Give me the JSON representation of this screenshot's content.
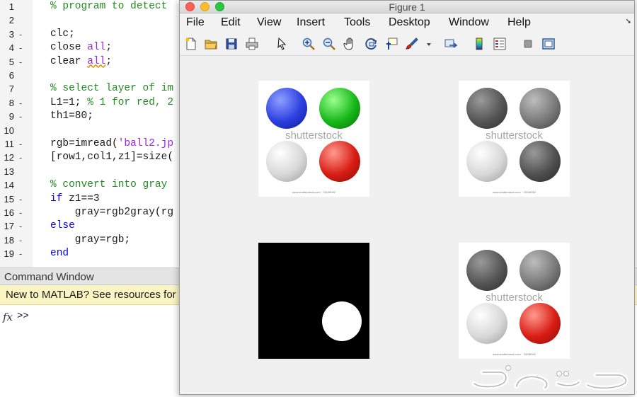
{
  "editor": {
    "lines": [
      {
        "num": "1",
        "marker": "",
        "code": "% program to detect "
      },
      {
        "num": "2",
        "marker": "",
        "code": ""
      },
      {
        "num": "3",
        "marker": "-",
        "code": "clc;"
      },
      {
        "num": "4",
        "marker": "-",
        "code": "close all;"
      },
      {
        "num": "5",
        "marker": "-",
        "code": "clear all;"
      },
      {
        "num": "6",
        "marker": "",
        "code": ""
      },
      {
        "num": "7",
        "marker": "",
        "code": "% select layer of im"
      },
      {
        "num": "8",
        "marker": "-",
        "code": "L1=1; % 1 for red, 2"
      },
      {
        "num": "9",
        "marker": "-",
        "code": "th1=80;"
      },
      {
        "num": "10",
        "marker": "",
        "code": ""
      },
      {
        "num": "11",
        "marker": "-",
        "code": "rgb=imread('ball2.jp"
      },
      {
        "num": "12",
        "marker": "-",
        "code": "[row1,col1,z1]=size("
      },
      {
        "num": "13",
        "marker": "",
        "code": ""
      },
      {
        "num": "14",
        "marker": "",
        "code": "% convert into gray "
      },
      {
        "num": "15",
        "marker": "-",
        "code": "if z1==3"
      },
      {
        "num": "16",
        "marker": "-",
        "code": "    gray=rgb2gray(rg"
      },
      {
        "num": "17",
        "marker": "-",
        "code": "else"
      },
      {
        "num": "18",
        "marker": "-",
        "code": "    gray=rgb;"
      },
      {
        "num": "19",
        "marker": "-",
        "code": "end"
      }
    ]
  },
  "command_window": {
    "title": "Command Window",
    "info": "New to MATLAB? See resources for",
    "fx": "fx",
    "prompt": ">>"
  },
  "figure": {
    "title": "Figure 1",
    "menus": [
      "File",
      "Edit",
      "View",
      "Insert",
      "Tools",
      "Desktop",
      "Window",
      "Help"
    ],
    "toolbar_icons": [
      "new-figure-icon",
      "open-file-icon",
      "save-icon",
      "print-icon",
      "pointer-icon",
      "zoom-in-icon",
      "zoom-out-icon",
      "pan-icon",
      "rotate-3d-icon",
      "data-cursor-icon",
      "brush-icon",
      "brush-dropdown-icon",
      "link-plot-icon",
      "colorbar-icon",
      "legend-icon",
      "hide-plot-tools-icon",
      "show-plot-tools-icon"
    ],
    "watermark": "shutterstock",
    "footer": "www.shutterstock.com · 78108052"
  },
  "colors": {
    "accent_blue": "#2b3fe0",
    "accent_green": "#17b81a",
    "accent_red": "#d81d14",
    "info_bar": "#fbf4c3"
  }
}
